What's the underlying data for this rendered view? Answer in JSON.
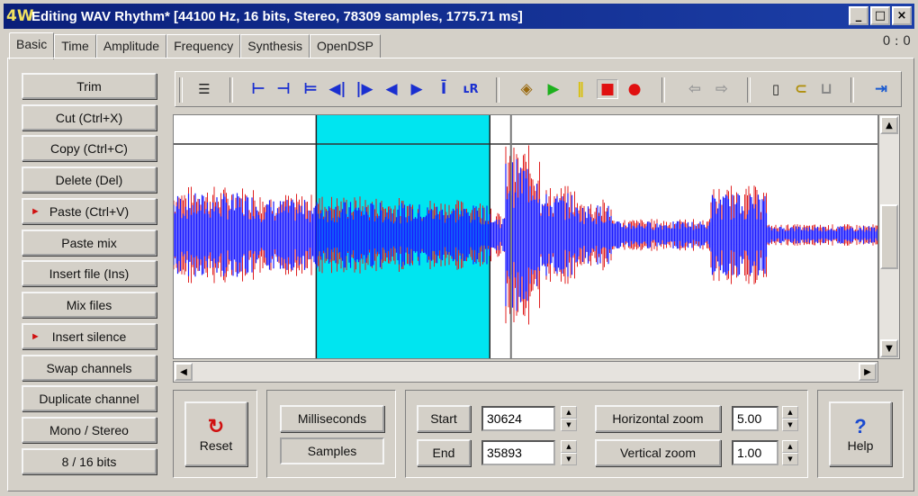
{
  "window": {
    "app_icon": "4W",
    "title": "Editing WAV Rhythm* [44100 Hz, 16 bits, Stereo, 78309 samples, 1775.71 ms]",
    "controls": [
      "_",
      "□",
      "×"
    ]
  },
  "tabs": [
    {
      "label": "Basic",
      "active": true
    },
    {
      "label": "Time"
    },
    {
      "label": "Amplitude"
    },
    {
      "label": "Frequency"
    },
    {
      "label": "Synthesis"
    },
    {
      "label": "OpenDSP"
    }
  ],
  "coords_readout": "0 : 0",
  "sidebar": {
    "items": [
      {
        "label": "Trim",
        "marked": false
      },
      {
        "label": "Cut (Ctrl+X)",
        "marked": false
      },
      {
        "label": "Copy (Ctrl+C)",
        "marked": false
      },
      {
        "label": "Delete (Del)",
        "marked": false
      },
      {
        "label": "Paste (Ctrl+V)",
        "marked": true
      },
      {
        "label": "Paste mix",
        "marked": false
      },
      {
        "label": "Insert file (Ins)",
        "marked": false
      },
      {
        "label": "Mix files",
        "marked": false
      },
      {
        "label": "Insert silence",
        "marked": true
      },
      {
        "label": "Swap channels",
        "marked": false
      },
      {
        "label": "Duplicate channel",
        "marked": false
      },
      {
        "label": "Mono / Stereo",
        "marked": false
      },
      {
        "label": "8 / 16 bits",
        "marked": false
      }
    ]
  },
  "toolbar": {
    "icons": [
      "list-icon",
      "go-start-icon",
      "go-end-icon",
      "select-all-icon",
      "prev-mark-icon",
      "next-mark-icon",
      "step-left-icon",
      "step-right-icon",
      "cursor-icon",
      "lr-channels-icon",
      "loop-play-icon",
      "play-icon",
      "pause-icon",
      "stop-icon",
      "record-icon",
      "undo-icon",
      "redo-icon",
      "new-file-icon",
      "open-file-icon",
      "save-icon",
      "exit-icon"
    ]
  },
  "waveform": {
    "selection_start_fraction": 0.202,
    "selection_end_fraction": 0.448,
    "selection_color": "#00e5f0",
    "wave_color_primary": "#1a1aff",
    "wave_color_secondary": "#e02020",
    "cursor_fraction": 0.478
  },
  "controls": {
    "reset_label": "Reset",
    "units": {
      "milliseconds": "Milliseconds",
      "samples": "Samples",
      "selected": "samples"
    },
    "start_label": "Start",
    "start_value": "30624",
    "end_label": "End",
    "end_value": "35893",
    "hzoom_label": "Horizontal zoom",
    "hzoom_value": "5.00",
    "vzoom_label": "Vertical zoom",
    "vzoom_value": "1.00",
    "help_label": "Help"
  }
}
